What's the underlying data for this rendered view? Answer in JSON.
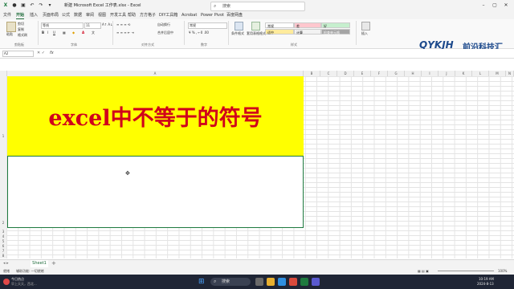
{
  "window": {
    "title": "新建 Microsoft Excel 工作表.xlsx - Excel",
    "search_placeholder": "搜索"
  },
  "menu": {
    "tabs": [
      "文件",
      "开始",
      "插入",
      "页面布局",
      "公式",
      "数据",
      "审阅",
      "视图",
      "开发工具",
      "帮助",
      "方方格子",
      "DIY工具箱",
      "Acrobat",
      "Power Pivot",
      "百度网盘"
    ],
    "active": "开始"
  },
  "ribbon": {
    "clipboard": {
      "paste": "粘贴",
      "cut": "剪切",
      "copy": "复制",
      "format_painter": "格式刷",
      "group": "剪贴板"
    },
    "font": {
      "name": "等线",
      "size": "11",
      "group": "字体"
    },
    "alignment": {
      "wrap": "自动换行",
      "merge": "合并后居中",
      "group": "对齐方式"
    },
    "number": {
      "format": "常规",
      "group": "数字"
    },
    "styles": {
      "conditional": "条件格式",
      "table": "套用表格格式",
      "group": "样式",
      "cells": [
        {
          "label": "常规",
          "bg": "#ffffff"
        },
        {
          "label": "差",
          "bg": "#ffc7ce"
        },
        {
          "label": "好",
          "bg": "#c6efce"
        },
        {
          "label": "适中",
          "bg": "#ffeb9c"
        },
        {
          "label": "计算",
          "bg": "#f2f2f2"
        },
        {
          "label": "检查单元格",
          "bg": "#a5a5a5"
        }
      ]
    },
    "cells_group": {
      "insert": "插入"
    }
  },
  "logo": {
    "brand": "QYKJH",
    "name": "前沿科技汇",
    "tagline": "FRONTIER TECHNOLOGY COLLECTION"
  },
  "formula_bar": {
    "name_box": "A2",
    "fx": "fx",
    "content": ""
  },
  "sheet": {
    "columns": [
      "A",
      "B",
      "C",
      "D",
      "E",
      "F",
      "G",
      "H",
      "I",
      "J",
      "K",
      "L",
      "M",
      "N",
      "O"
    ],
    "rows": [
      "1",
      "2",
      "3",
      "4",
      "5",
      "6",
      "7",
      "8",
      "9",
      "10",
      "11",
      "12",
      "13",
      "14",
      "15"
    ],
    "cell_a1": "excel中不等于的符号"
  },
  "sheet_tabs": {
    "active": "Sheet1",
    "add": "+"
  },
  "status": {
    "ready": "就绪",
    "accessibility": "辅助功能: 一切就绪",
    "zoom": "100%"
  },
  "taskbar": {
    "weather_title": "今日热点",
    "weather_sub": "早上天天，西北...",
    "search": "搜索",
    "time": "10:19 AM",
    "date": "2024-8-13"
  }
}
